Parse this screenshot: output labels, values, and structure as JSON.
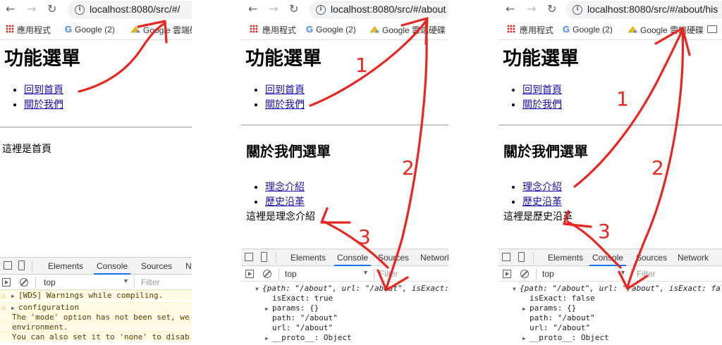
{
  "browser": {
    "back_icon": "back-arrow-icon",
    "forward_icon": "forward-arrow-icon",
    "reload_icon": "reload-icon",
    "bookmarks": {
      "apps": "應用程式",
      "google": "Google (2)",
      "drive": "Google 雲端硬碟"
    }
  },
  "panels": [
    {
      "url": "localhost:8080/src/#/",
      "drive_label": "Google 雲端硬",
      "title": "功能選單",
      "links": [
        "回到首頁",
        "關於我們"
      ],
      "body_text": "這裡是首頁",
      "devtools": {
        "tabs": [
          "Elements",
          "Console",
          "Sources",
          "Ne"
        ],
        "context": "top",
        "filter_placeholder": "Filter",
        "lines": [
          {
            "kind": "warning",
            "text": "[WDS] Warnings while compiling."
          },
          {
            "kind": "warning",
            "text": "configuration"
          },
          {
            "kind": "plain",
            "text": "The 'mode' option has not been set, we"
          },
          {
            "kind": "plain",
            "text": "environment."
          },
          {
            "kind": "plain",
            "text": "You can also set it to 'none' to disab"
          }
        ]
      }
    },
    {
      "url": "localhost:8080/src/#/about",
      "drive_label": "Google 雲端硬碟",
      "title": "功能選單",
      "links": [
        "回到首頁",
        "關於我們"
      ],
      "subtitle": "關於我們選單",
      "sublinks": [
        "理念介紹",
        "歷史沿革"
      ],
      "body_text": "這裡是理念介紹",
      "devtools": {
        "tabs": [
          "Elements",
          "Console",
          "Sources",
          "Network"
        ],
        "context": "top",
        "filter_placeholder": "Filter",
        "summary": "{path: \"/about\", url: \"/about\", isExact:",
        "isExact": "isExact: true",
        "params": "params: {}",
        "path": "path: \"/about\"",
        "url": "url: \"/about\"",
        "proto": "__proto__: Object"
      }
    },
    {
      "url": "localhost:8080/src/#/about/his",
      "drive_label": "Google 雲端硬碟",
      "title": "功能選單",
      "links": [
        "回到首頁",
        "關於我們"
      ],
      "subtitle": "關於我們選單",
      "sublinks": [
        "理念介紹",
        "歷史沿革"
      ],
      "body_text": "這裡是歷史沿革",
      "devtools": {
        "tabs": [
          "Elements",
          "Console",
          "Sources",
          "Network"
        ],
        "context": "top",
        "filter_placeholder": "Filter",
        "summary": "{path: \"/about\", url: \"/about\", isExact: false",
        "isExact": "isExact: false",
        "params": "params: {}",
        "path": "path: \"/about\"",
        "url": "url: \"/about\"",
        "proto": "__proto__: Object"
      }
    }
  ],
  "annotations": {
    "color": "#e8261f",
    "numbers": [
      "1",
      "2",
      "3",
      "1",
      "2",
      "3"
    ]
  }
}
